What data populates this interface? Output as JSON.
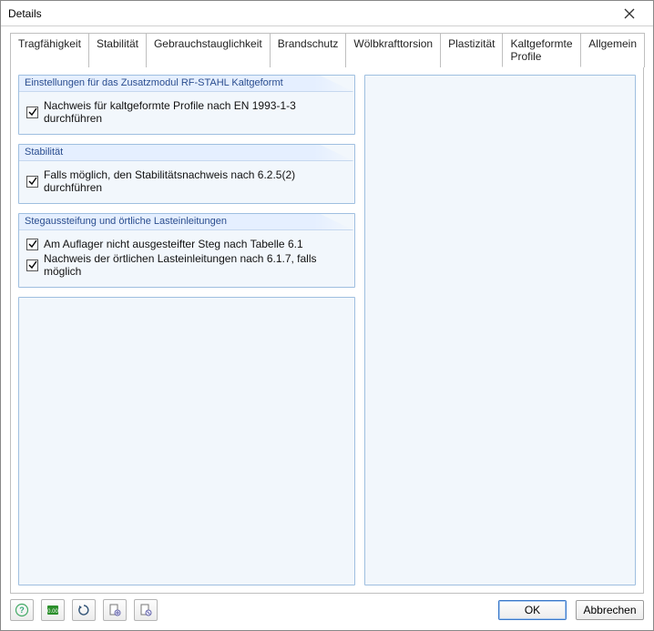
{
  "window": {
    "title": "Details"
  },
  "tabs": [
    {
      "label": "Tragfähigkeit"
    },
    {
      "label": "Stabilität"
    },
    {
      "label": "Gebrauchstauglichkeit"
    },
    {
      "label": "Brandschutz"
    },
    {
      "label": "Wölbkrafttorsion"
    },
    {
      "label": "Plastizität"
    },
    {
      "label": "Kaltgeformte Profile",
      "active": true
    },
    {
      "label": "Allgemein"
    }
  ],
  "groups": {
    "module": {
      "title": "Einstellungen für das Zusatzmodul RF-STAHL Kaltgeformt",
      "check1": {
        "label": "Nachweis für kaltgeformte Profile nach EN 1993-1-3 durchführen",
        "checked": true
      }
    },
    "stability": {
      "title": "Stabilität",
      "check1": {
        "label": "Falls möglich, den Stabilitätsnachweis nach 6.2.5(2) durchführen",
        "checked": true
      }
    },
    "stiffener": {
      "title": "Stegaussteifung und örtliche Lasteinleitungen",
      "check1": {
        "label": "Am Auflager nicht ausgesteifter Steg nach Tabelle 6.1",
        "checked": true
      },
      "check2": {
        "label": "Nachweis der örtlichen Lasteinleitungen nach 6.1.7, falls möglich",
        "checked": true
      }
    }
  },
  "footer": {
    "ok": "OK",
    "cancel": "Abbrechen"
  },
  "icons": {
    "help": "help-icon",
    "units": "units-icon",
    "reset": "reset-icon",
    "norm1": "page-norm-icon",
    "norm2": "page-norm-icon"
  }
}
